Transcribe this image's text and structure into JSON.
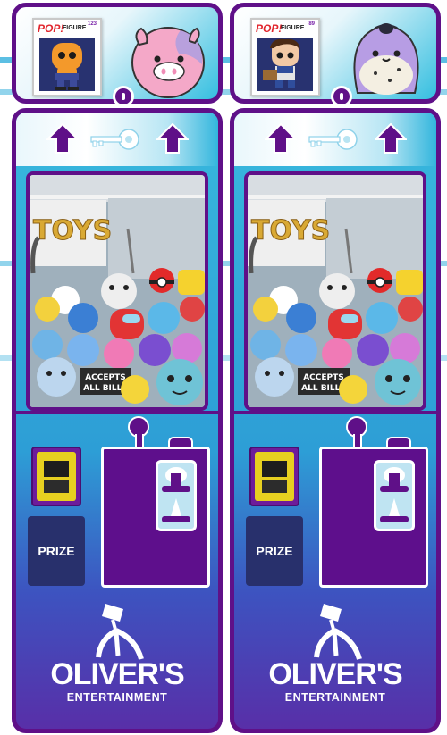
{
  "machines": [
    {
      "pop": {
        "brand": "POP!",
        "type": "FIGURE",
        "number": "123"
      },
      "plush": "pink-cow-plush",
      "prize_label": "PRIZE",
      "logo": {
        "name": "OLIVER'S",
        "sub": "ENTERTAINMENT"
      },
      "sign": {
        "line1": "ACCEPTS",
        "line2": "ALL BILLS"
      }
    },
    {
      "pop": {
        "brand": "POP!",
        "type": "FIGURE",
        "number": "89"
      },
      "plush": "purple-ghost-plush",
      "prize_label": "PRIZE",
      "logo": {
        "name": "OLIVER'S",
        "sub": "ENTERTAINMENT"
      },
      "sign": {
        "line1": "ACCEPTS",
        "line2": "ALL BILLS"
      }
    }
  ],
  "glass_banner": "TOYS",
  "colors": {
    "cabinet_border": "#5f1088",
    "cabinet_top": "#38b8dd",
    "cabinet_bottom": "#582fa8",
    "prize_panel": "#28306c"
  }
}
